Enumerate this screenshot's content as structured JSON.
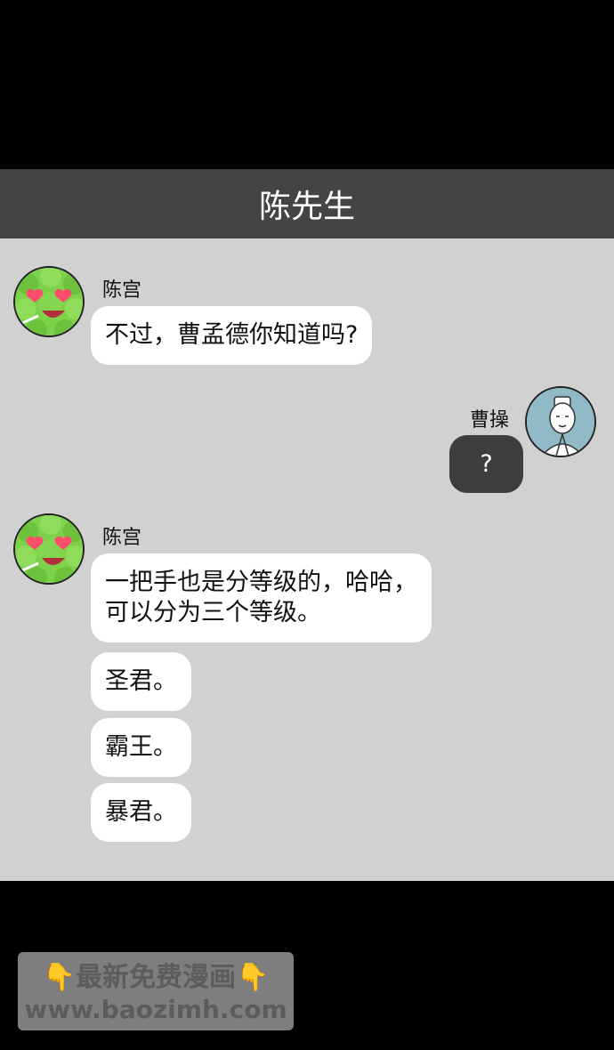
{
  "header": {
    "title": "陈先生"
  },
  "messages": [
    {
      "sender": "陈宫",
      "side": "left",
      "bubbles": [
        "不过，曹孟德你知道吗?"
      ]
    },
    {
      "sender": "曹操",
      "side": "right",
      "bubbles": [
        "?"
      ]
    },
    {
      "sender": "陈宫",
      "side": "left",
      "bubbles": [
        "一把手也是分等级的，哈哈，\n可以分为三个等级。",
        "圣君。",
        "霸王。",
        "暴君。"
      ]
    }
  ],
  "watermark": {
    "line1": "最新免费漫画",
    "line2": "www.baozimh.com",
    "hand_icon": "👇"
  },
  "colors": {
    "header_bg": "#444444",
    "chat_bg": "#d1d1d1",
    "right_bubble": "#3d3d3d",
    "avatar_green": "#7dd24a"
  }
}
